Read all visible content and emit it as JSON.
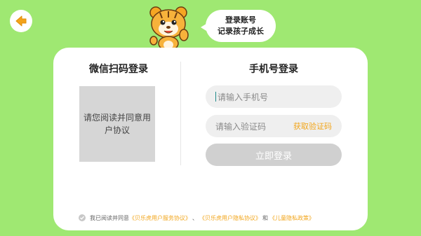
{
  "bubble": {
    "line1": "登录账号",
    "line2": "记录孩子成长"
  },
  "wechat": {
    "title": "微信扫码登录",
    "qr_placeholder": "请您阅读并同意用户协议"
  },
  "phone_login": {
    "title": "手机号登录",
    "phone_placeholder": "请输入手机号",
    "code_placeholder": "请输入验证码",
    "get_code": "获取验证码",
    "submit": "立即登录"
  },
  "agreement": {
    "prefix": "我已阅读并同意",
    "link1": "《贝乐虎用户服务协议》",
    "sep1": "、",
    "link2": "《贝乐虎用户隐私协议》",
    "sep2": "和",
    "link3": "《儿童隐私政策》"
  },
  "colors": {
    "background": "#9fe872",
    "accent": "#f2a61c",
    "disabled": "#d0d0d0"
  },
  "icons": {
    "back": "back-arrow-icon",
    "mascot": "tiger-mascot-icon",
    "check": "check-circle-icon"
  }
}
